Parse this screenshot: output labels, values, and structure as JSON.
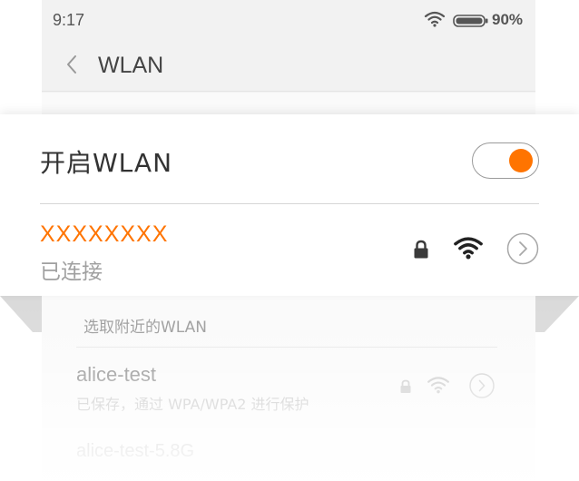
{
  "statusbar": {
    "time": "9:17",
    "battery": "90%"
  },
  "navbar": {
    "title": "WLAN"
  },
  "overlay": {
    "wlan_label": "开启WLAN",
    "toggle_on": true,
    "connected_ssid": "XXXXXXXX",
    "connected_status": "已连接"
  },
  "nearby": {
    "section_label": "选取附近的WLAN",
    "networks": [
      {
        "name": "alice-test",
        "status": "已保存，通过 WPA/WPA2 进行保护"
      },
      {
        "name": "alice-test-5.8G"
      }
    ]
  },
  "colors": {
    "accent": "#ff7400",
    "icon_dark": "#3a3a3a",
    "icon_faded": "#c8c8c8"
  },
  "icons": [
    "wifi-icon",
    "battery-icon",
    "back-icon",
    "lock-icon",
    "chevron-right-icon"
  ]
}
